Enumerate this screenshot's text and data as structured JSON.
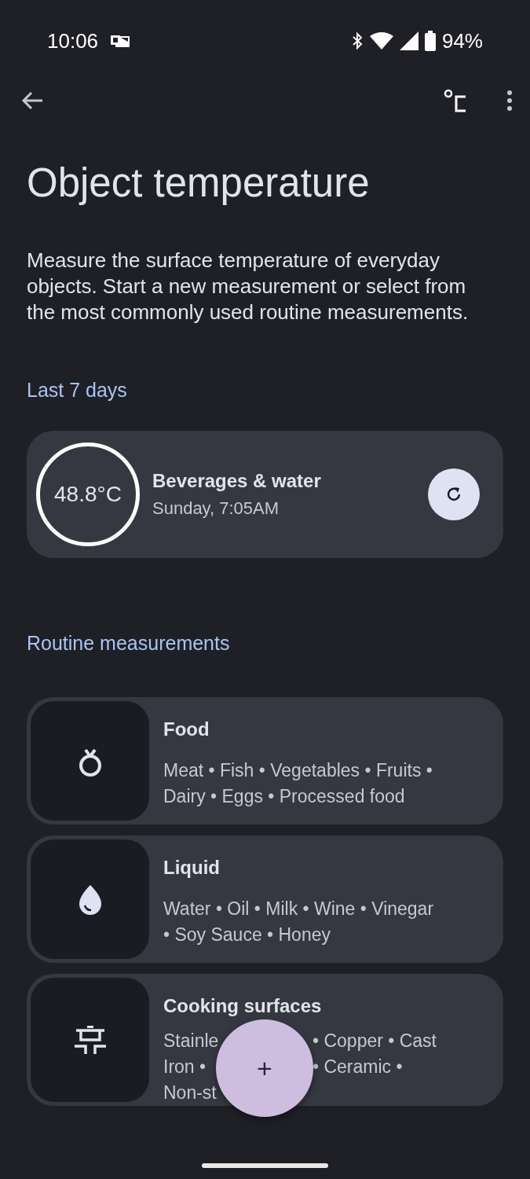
{
  "status_bar": {
    "time": "10:06",
    "battery": "94%"
  },
  "title": "Object temperature",
  "description": "Measure the surface temperature of everyday objects. Start a new measurement or select from the most commonly used routine measurements.",
  "recent": {
    "heading": "Last 7 days",
    "items": [
      {
        "reading": "48.8°C",
        "name": "Beverages & water",
        "time": "Sunday, 7:05AM"
      }
    ]
  },
  "routine": {
    "heading": "Routine measurements",
    "items": [
      {
        "kind": "food",
        "title": "Food",
        "lines": [
          {
            "left": "Meat • Fish • Vegetables • Fruits •"
          },
          {
            "left": "Dairy • Eggs • Processed food"
          }
        ]
      },
      {
        "kind": "liquid",
        "title": "Liquid",
        "lines": [
          {
            "left": "Water • Oil • Milk • Wine • Vinegar"
          },
          {
            "left": "• Soy Sauce • Honey"
          }
        ]
      },
      {
        "kind": "surface",
        "title": "Cooking surfaces",
        "lines": [
          {
            "left": "Stainle",
            "right": "• Copper • Cast"
          },
          {
            "left": "Iron •",
            "right": "• Ceramic •"
          },
          {
            "left": "Non-st"
          }
        ]
      }
    ]
  },
  "fab": {
    "label": "+"
  }
}
